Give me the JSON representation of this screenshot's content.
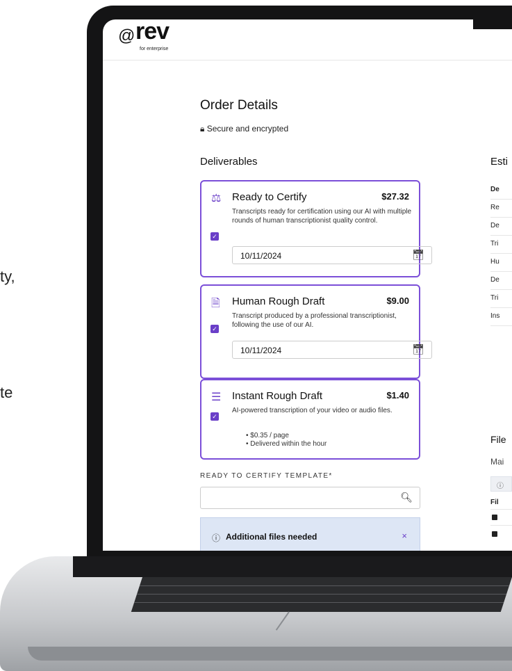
{
  "side_text": {
    "line1": "ty,",
    "line2": "te"
  },
  "app": {
    "logo_mark": "@",
    "logo_word": "rev",
    "logo_sub": "for enterprise"
  },
  "page": {
    "title": "Order Details",
    "secure_label": "Secure and encrypted",
    "deliverables_heading": "Deliverables",
    "right_heading": "Esti"
  },
  "deliverables": [
    {
      "title": "Ready to Certify",
      "price": "$27.32",
      "description": "Transcripts ready for certification using our AI with multiple rounds of human transcriptionist quality control.",
      "date": "10/11/2024",
      "checked": true,
      "icon": "gavel-icon"
    },
    {
      "title": "Human Rough Draft",
      "price": "$9.00",
      "description": "Transcript produced by a professional transcriptionist, following the use of our AI.",
      "date": "10/11/2024",
      "checked": true,
      "icon": "document-icon"
    },
    {
      "title": "Instant Rough Draft",
      "price": "$1.40",
      "description": "AI-powered transcription of your video or audio files.",
      "bullets": [
        "$0.35 / page",
        "Delivered within the hour"
      ],
      "checked": true,
      "icon": "list-document-icon"
    }
  ],
  "template": {
    "label": "READY TO CERTIFY TEMPLATE*",
    "value": ""
  },
  "alert": {
    "text": "Additional files needed",
    "close": "×"
  },
  "right_table": {
    "header": "De",
    "rows": [
      "Re",
      "De",
      "Tri",
      "Hu",
      "De",
      "Tri",
      "Ins"
    ]
  },
  "files": {
    "heading": "File",
    "subheading": "Mai",
    "info": "ⓘ",
    "column": "Fil"
  },
  "colors": {
    "accent": "#6a3fc8",
    "alert_bg": "#dde6f5"
  }
}
